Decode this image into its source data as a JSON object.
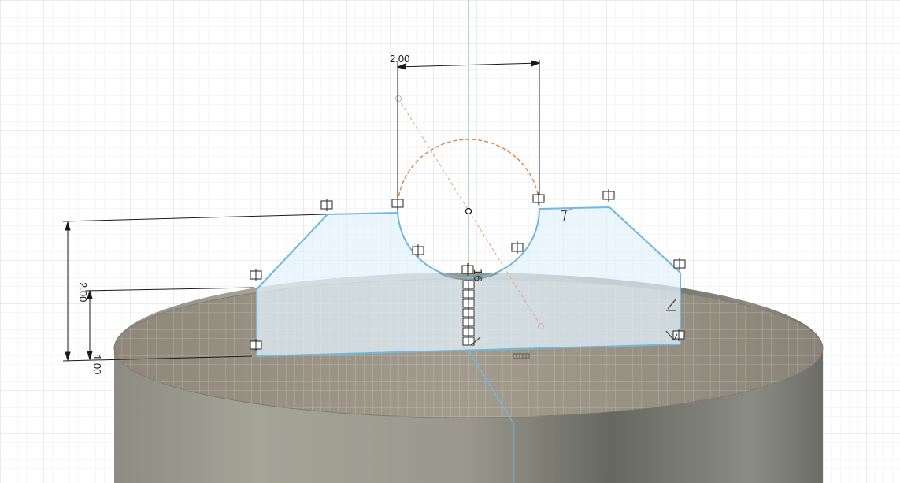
{
  "sketch": {
    "dimensions": {
      "top_width": "2.00",
      "left_height": "2.00",
      "left_lower": "1.00"
    },
    "colors": {
      "profile": "#6fb8de",
      "profile_fill": "#e3f2fb",
      "construction": "#e0833c",
      "axis": "#7ad07a",
      "dimension": "#1a1a1a"
    },
    "constraint_icons": {
      "coincident": "coincident-icon",
      "perpendicular": "perpendicular-icon",
      "parallel": "parallel-icon",
      "horizontal": "horizontal-icon"
    }
  }
}
